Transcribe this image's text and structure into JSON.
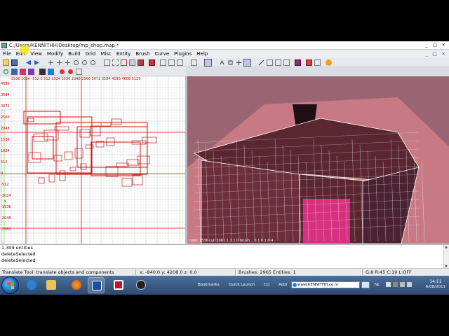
{
  "window": {
    "title": "C:/Users/KENNITHH/Desktop/mp_shop.map *",
    "controls": [
      "_",
      "□",
      "×"
    ]
  },
  "menu": {
    "items": [
      "File",
      "Edit",
      "View",
      "Modify",
      "Build",
      "Grid",
      "Misc",
      "Entity",
      "Brush",
      "Curve",
      "Plugins",
      "Help"
    ],
    "right": "_ □ ×"
  },
  "xy_view": {
    "ruler_x": "-1536 1024 -512 0    512   1024  1536  2048  2560  3072  3584  4096  4608  5120",
    "ruler_y": [
      "4096",
      "3584",
      "3072",
      "2560",
      "2048",
      "1536",
      "1024",
      "512",
      "0",
      "-512",
      "-1024",
      "-1536",
      "-2048",
      "-2560"
    ],
    "origin_label": "x"
  },
  "camera_view": {
    "status": "cubic  1536  cull  3061  1  1  1  0  brush ..  0  1  0  1  0  4",
    "colors": {
      "sky": "#9a6472",
      "floor": "#c77a84",
      "wire": "#ffffff",
      "pink_wall": "#d6307e",
      "dark": "#1f0f14"
    }
  },
  "console": {
    "lines": [
      "1,309 entities",
      "deleteSelected",
      "deleteSelected"
    ]
  },
  "status": {
    "tool": "Translate Tool: translate objects and components",
    "coords": "x: -840.0  y: 4208.0  z:  0.0",
    "brushes": "Brushes: 2965 Entities: 1",
    "grid": "G:8  R:45  C:19  L:OFF"
  },
  "taskbar": {
    "bookmarks_label": "Bookmarks",
    "quick_launch_label": "Quick Launch",
    "cd_label": "CD",
    "address_label": "Addr",
    "address_value": "www.KENNITHH.co.nr",
    "lang": "NL",
    "time": "14:11",
    "date": "6/08/2011"
  }
}
